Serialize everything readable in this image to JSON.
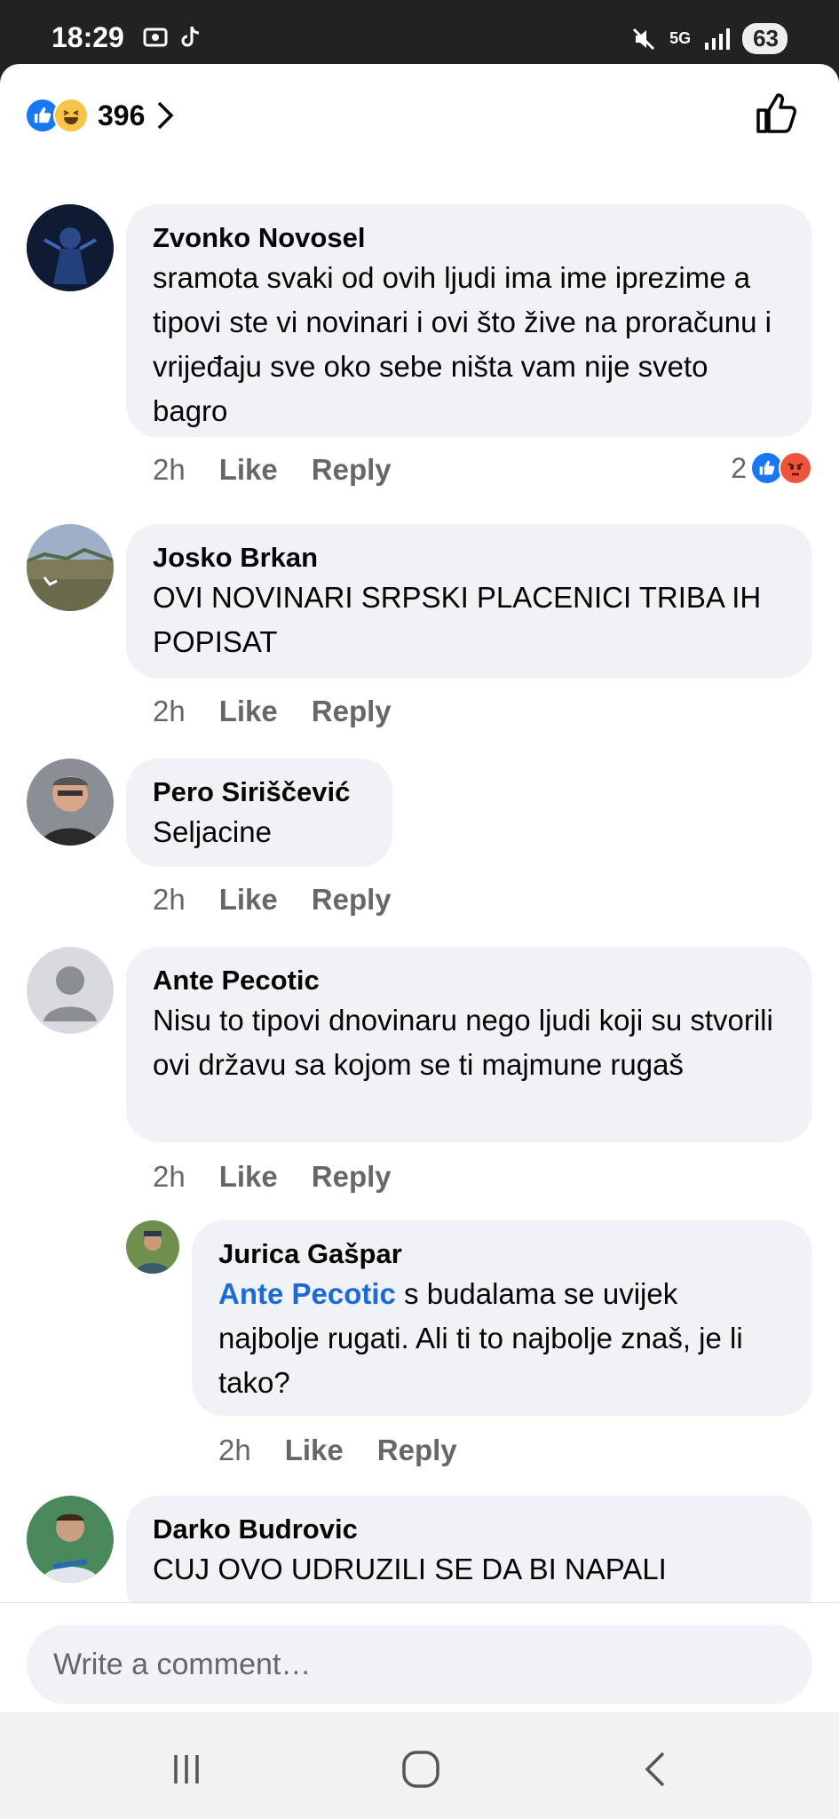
{
  "status": {
    "time": "18:29",
    "battery": "63",
    "network": "5G"
  },
  "header": {
    "reaction_count": "396",
    "reaction_icons": [
      "like-icon",
      "haha-icon"
    ]
  },
  "comments": [
    {
      "author": "Zvonko Novosel",
      "text": "sramota svaki od ovih ljudi ima ime iprezime a tipovi ste vi novinari i ovi što žive na proračunu i vrijeđaju sve oko sebe ništa vam nije sveto bagro",
      "time": "2h",
      "like": "Like",
      "reply": "Reply",
      "reactions_count": "2"
    },
    {
      "author": "Josko Brkan",
      "text": "OVI NOVINARI SRPSKI PLACENICI TRIBA IH POPISAT",
      "time": "2h",
      "like": "Like",
      "reply": "Reply"
    },
    {
      "author": "Pero Siriščević",
      "text": "Seljacine",
      "time": "2h",
      "like": "Like",
      "reply": "Reply"
    },
    {
      "author": "Ante Pecotic",
      "text": "Nisu to tipovi dnovinaru nego ljudi koji su stvorili ovi državu sa kojom se ti majmune rugaš",
      "time": "2h",
      "like": "Like",
      "reply": "Reply"
    },
    {
      "author": "Jurica Gašpar",
      "mention": "Ante Pecotic",
      "text": " s budalama se uvijek najbolje rugati. Ali ti to najbolje znaš, je li tako?",
      "time": "2h",
      "like": "Like",
      "reply": "Reply"
    },
    {
      "author": "Darko Budrovic",
      "text": "CUJ OVO UDRUZILI SE DA BI NAPALI"
    }
  ],
  "composer": {
    "placeholder": "Write a comment…"
  },
  "colors": {
    "accent": "#1877f2",
    "bubble": "#f0f2f5",
    "meta": "#65676b",
    "mention": "#1b6ad5",
    "angry": "#f0533b"
  }
}
